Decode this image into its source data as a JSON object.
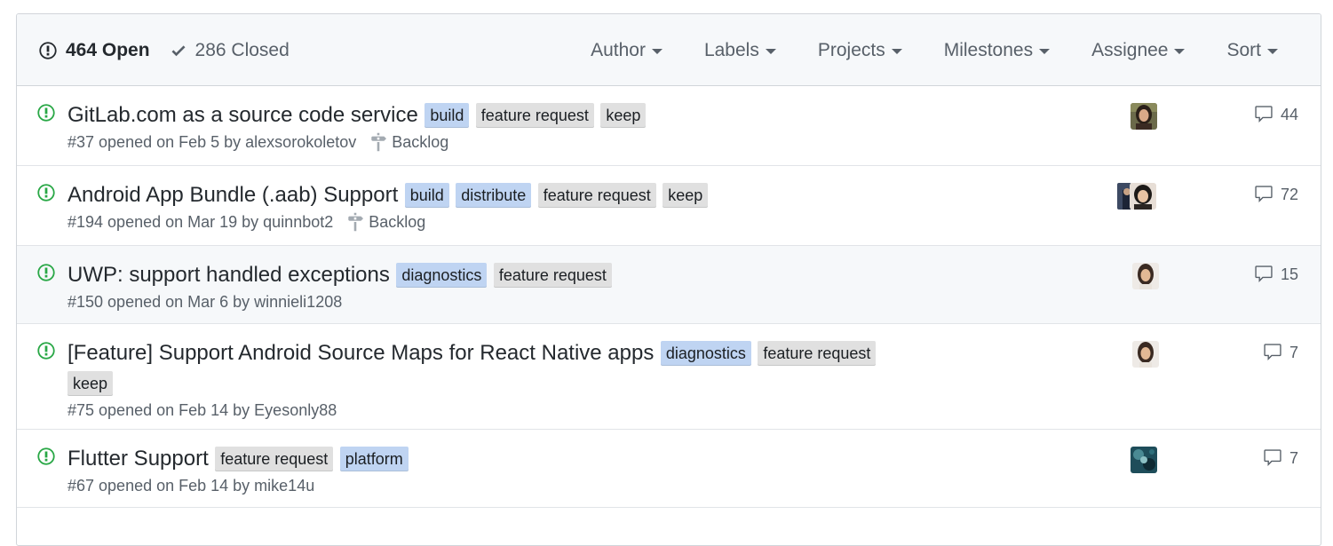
{
  "header": {
    "open_count": "464 Open",
    "closed_count": "286 Closed",
    "filters": [
      "Author",
      "Labels",
      "Projects",
      "Milestones",
      "Assignee",
      "Sort"
    ]
  },
  "label_colors": {
    "build": "#bfd4f2",
    "distribute": "#bfd4f2",
    "diagnostics": "#bfd4f2",
    "platform": "#bfd4f2",
    "feature request": "#e0e0e0",
    "keep": "#e0e0e0"
  },
  "issues": [
    {
      "title": "GitLab.com as a source code service",
      "labels": [
        "build",
        "feature request",
        "keep"
      ],
      "meta": "#37 opened on Feb 5 by alexsorokoletov",
      "milestone": "Backlog",
      "comments": "44"
    },
    {
      "title": "Android App Bundle (.aab) Support",
      "labels": [
        "build",
        "distribute",
        "feature request",
        "keep"
      ],
      "meta": "#194 opened on Mar 19 by quinnbot2",
      "milestone": "Backlog",
      "comments": "72"
    },
    {
      "title": "UWP: support handled exceptions",
      "labels": [
        "diagnostics",
        "feature request"
      ],
      "meta": "#150 opened on Mar 6 by winnieli1208",
      "milestone": "",
      "comments": "15"
    },
    {
      "title": "[Feature] Support Android Source Maps for React Native apps",
      "labels": [
        "diagnostics",
        "feature request",
        "keep"
      ],
      "meta": "#75 opened on Feb 14 by Eyesonly88",
      "milestone": "",
      "comments": "7"
    },
    {
      "title": "Flutter Support",
      "labels": [
        "feature request",
        "platform"
      ],
      "meta": "#67 opened on Feb 14 by mike14u",
      "milestone": "",
      "comments": "7"
    }
  ]
}
